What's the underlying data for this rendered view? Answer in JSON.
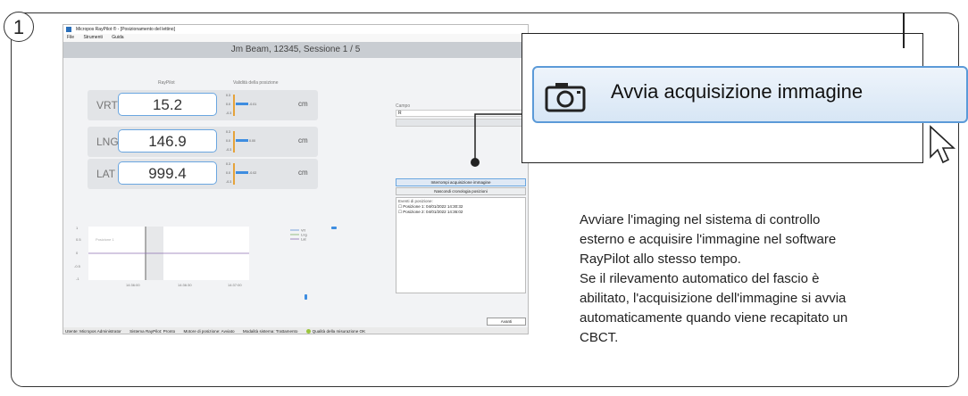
{
  "step_number": "1",
  "app": {
    "window_title": "Micropos RayPilot ® - [Posizionamento del lettino]",
    "menu": [
      "File",
      "Strumenti",
      "Guida"
    ],
    "header_title": "Jm Beam, 12345, Sessione 1 / 5",
    "col_raypilot": "RayPilot",
    "col_validity": "Validità della posizione",
    "rows": [
      {
        "label": "VRT",
        "value": "15.2",
        "gauge_top": "0.3",
        "gauge_mid": "0.0",
        "gauge_bot": "-0.3",
        "delta": "-0.01",
        "unit": "cm"
      },
      {
        "label": "LNG",
        "value": "146.9",
        "gauge_top": "0.3",
        "gauge_mid": "0.0",
        "gauge_bot": "-0.3",
        "delta": "0.00",
        "unit": "cm"
      },
      {
        "label": "LAT",
        "value": "999.4",
        "gauge_top": "0.3",
        "gauge_mid": "0.0",
        "gauge_bot": "-0.3",
        "delta": "-0.02",
        "unit": "cm"
      }
    ],
    "campo_label": "Campo",
    "campo_value": "R",
    "stop_capture_button": "Interrompi acquisizione immagine",
    "hide_history_button": "Nascondi cronologia posizioni",
    "events_label": "Eventi di posizione:",
    "events": [
      "Posizione 1: 04/01/2022 14:30:32",
      "Posizione 2: 04/01/2022 14:36:02"
    ],
    "chart_x_ticks": [
      "14:36:00",
      "14:36:30",
      "14:37:00"
    ],
    "chart_y_ticks": [
      "1",
      "0.5",
      "0",
      "-0.5",
      "-1"
    ],
    "chart_legend": [
      "Vrt",
      "Lng",
      "Lat"
    ],
    "chart_annotation": "Posizione 1",
    "next_button": "Avanti",
    "status": [
      "Utente: Micropos Administrator",
      "Sistema RayPilot: Pronto",
      "Motore di posizione: Avviato",
      "Modalità sistema: Trattamento",
      "Qualità della misurazione OK"
    ]
  },
  "callout": {
    "button_label": "Avvia acquisizione immagine",
    "icon": "camera-icon",
    "cursor_icon": "mouse-pointer-icon"
  },
  "description": [
    "Avviare l'imaging nel sistema di controllo",
    "esterno e acquisire l'immagine nel software",
    "RayPilot allo stesso tempo.",
    "Se il rilevamento automatico del fascio è",
    "abilitato, l'acquisizione dell'immagine si avvia",
    "automaticamente quando viene recapitato un",
    "CBCT."
  ],
  "colors": {
    "accent": "#5b9ad8",
    "header": "#c9cdd2",
    "gauge_bar": "#e5a33a",
    "status_ok": "#9bc53d"
  }
}
